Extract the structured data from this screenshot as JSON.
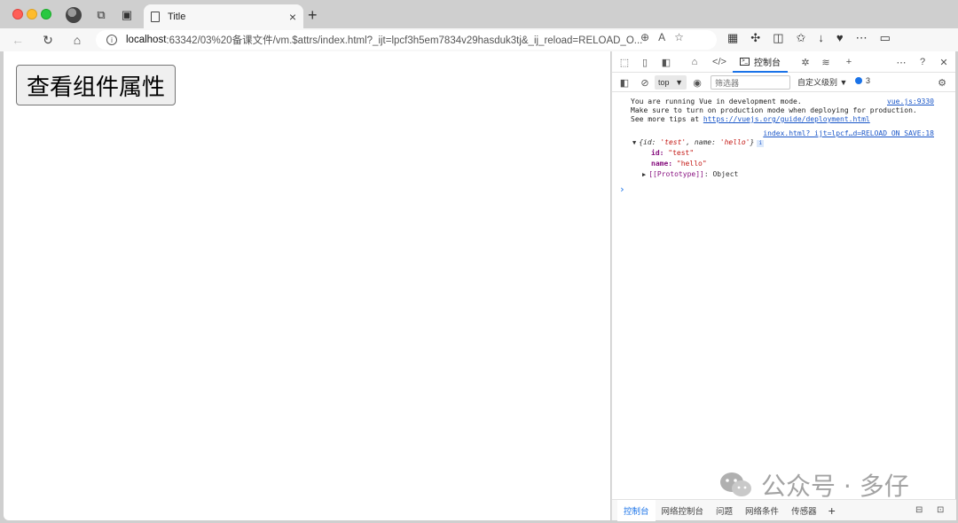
{
  "browser": {
    "tab_title": "Title",
    "url_host": "localhost",
    "url_rest": ":63342/03%20备课文件/vm.$attrs/index.html?_ijt=lpcf3h5em7834v29hasduk3tj&_ij_reload=RELOAD_O..."
  },
  "page": {
    "button_label": "查看组件属性"
  },
  "devtools": {
    "active_tab": "控制台",
    "context": "top",
    "filter_placeholder": "筛选器",
    "levels": "自定义级别 ▼",
    "issues_count": "3",
    "console": {
      "vue_line1": "You are running Vue in development mode.",
      "vue_line2": "Make sure to turn on production mode when deploying for production.",
      "vue_line3_prefix": "See more tips at ",
      "vue_line3_link": "https://vuejs.org/guide/deployment.html",
      "vue_source": "vue.js:9330",
      "log_source": "index.html?_ijt=lpcf…d=RELOAD_ON_SAVE:18",
      "obj_open": "{id: ",
      "obj_id_val": "'test'",
      "obj_mid": ", name: ",
      "obj_name_val": "'hello'",
      "obj_close": "}",
      "prop_id_key": "id:",
      "prop_id_val": "\"test\"",
      "prop_name_key": "name:",
      "prop_name_val": "\"hello\"",
      "proto_key": "[[Prototype]]",
      "proto_val": ": Object",
      "prompt": "›"
    },
    "bottom_tabs": [
      "控制台",
      "网络控制台",
      "问题",
      "网络条件",
      "传感器"
    ]
  },
  "watermark": {
    "text": "公众号 · 多仔"
  }
}
